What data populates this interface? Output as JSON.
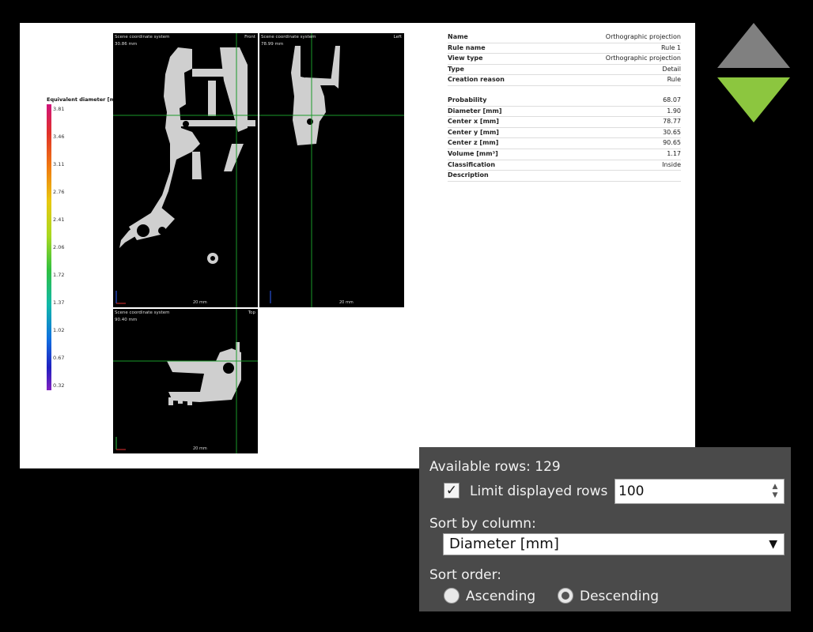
{
  "legend": {
    "title": "Equivalent diameter [mm]",
    "ticks": [
      "3.81",
      "3.46",
      "3.11",
      "2.76",
      "2.41",
      "2.06",
      "1.72",
      "1.37",
      "1.02",
      "0.67",
      "0.32"
    ]
  },
  "views": {
    "front": {
      "title": "Scene coordinate system",
      "sub": "30.86 mm",
      "dir": "Front",
      "scale": "20 mm"
    },
    "left": {
      "title": "Scene coordinate system",
      "sub": "78.99 mm",
      "dir": "Left",
      "scale": "20 mm"
    },
    "top": {
      "title": "Scene coordinate system",
      "sub": "90.40 mm",
      "dir": "Top",
      "scale": "20 mm"
    }
  },
  "properties": {
    "group1": [
      {
        "key": "Name",
        "value": "Orthographic projection"
      },
      {
        "key": "Rule name",
        "value": "Rule 1"
      },
      {
        "key": "View type",
        "value": "Orthographic projection"
      },
      {
        "key": "Type",
        "value": "Detail"
      },
      {
        "key": "Creation reason",
        "value": "Rule"
      }
    ],
    "group2": [
      {
        "key": "Probability",
        "value": "68.07"
      },
      {
        "key": "Diameter [mm]",
        "value": "1.90"
      },
      {
        "key": "Center x [mm]",
        "value": "78.77"
      },
      {
        "key": "Center y [mm]",
        "value": "30.65"
      },
      {
        "key": "Center z [mm]",
        "value": "90.65"
      },
      {
        "key": "Volume [mm³]",
        "value": "1.17"
      },
      {
        "key": "Classification",
        "value": "Inside"
      },
      {
        "key": "Description",
        "value": ""
      }
    ]
  },
  "nav": {
    "up_color": "#808080",
    "down_color": "#8cc63f",
    "up_icon": "triangle-up-icon",
    "down_icon": "triangle-down-icon"
  },
  "panel": {
    "available_rows": "Available rows: 129",
    "limit_label": "Limit displayed rows",
    "limit_checked": true,
    "limit_value": "100",
    "sort_by_label": "Sort by column:",
    "sort_by_value": "Diameter [mm]",
    "sort_order_label": "Sort order:",
    "ascending_label": "Ascending",
    "descending_label": "Descending",
    "sort_order_selected": "Descending"
  }
}
